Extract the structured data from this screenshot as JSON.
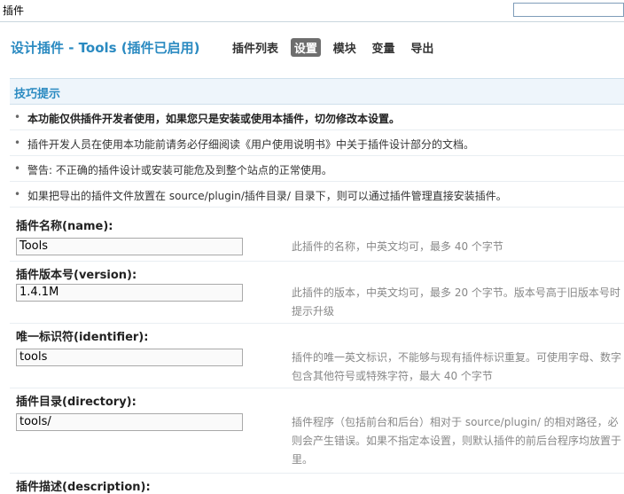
{
  "window": {
    "title": "插件"
  },
  "header": {
    "title": "设计插件 - Tools (插件已启用)",
    "nav": [
      "插件列表",
      "设置",
      "模块",
      "变量",
      "导出"
    ]
  },
  "tips": {
    "heading": "技巧提示",
    "items": [
      "本功能仅供插件开发者使用，如果您只是安装或使用本插件，切勿修改本设置。",
      "插件开发人员在使用本功能前请务必仔细阅读《用户使用说明书》中关于插件设计部分的文档。",
      "警告: 不正确的插件设计或安装可能危及到整个站点的正常使用。",
      "如果把导出的插件文件放置在 source/plugin/插件目录/ 目录下，则可以通过插件管理直接安装插件。"
    ]
  },
  "form": {
    "fields": [
      {
        "label": "插件名称(name):",
        "value": "Tools",
        "help": [
          "此插件的名称，中英文均可，最多 40 个字节"
        ]
      },
      {
        "label": "插件版本号(version):",
        "value": "1.4.1M",
        "help": [
          "此插件的版本，中英文均可，最多 20 个字节。版本号高于旧版本号时",
          "提示升级"
        ]
      },
      {
        "label": "唯一标识符(identifier):",
        "value": "tools",
        "help": [
          "插件的唯一英文标识，不能够与现有插件标识重复。可使用字母、数字",
          "包含其他符号或特殊字符，最大 40 个字节"
        ]
      },
      {
        "label": "插件目录(directory):",
        "value": "tools/",
        "help": [
          "插件程序（包括前台和后台）相对于 source/plugin/ 的相对路径，必",
          "则会产生错误。如果不指定本设置，则默认插件的前后台程序均放置于",
          "里。"
        ]
      },
      {
        "label": "插件描述(description):"
      }
    ]
  }
}
